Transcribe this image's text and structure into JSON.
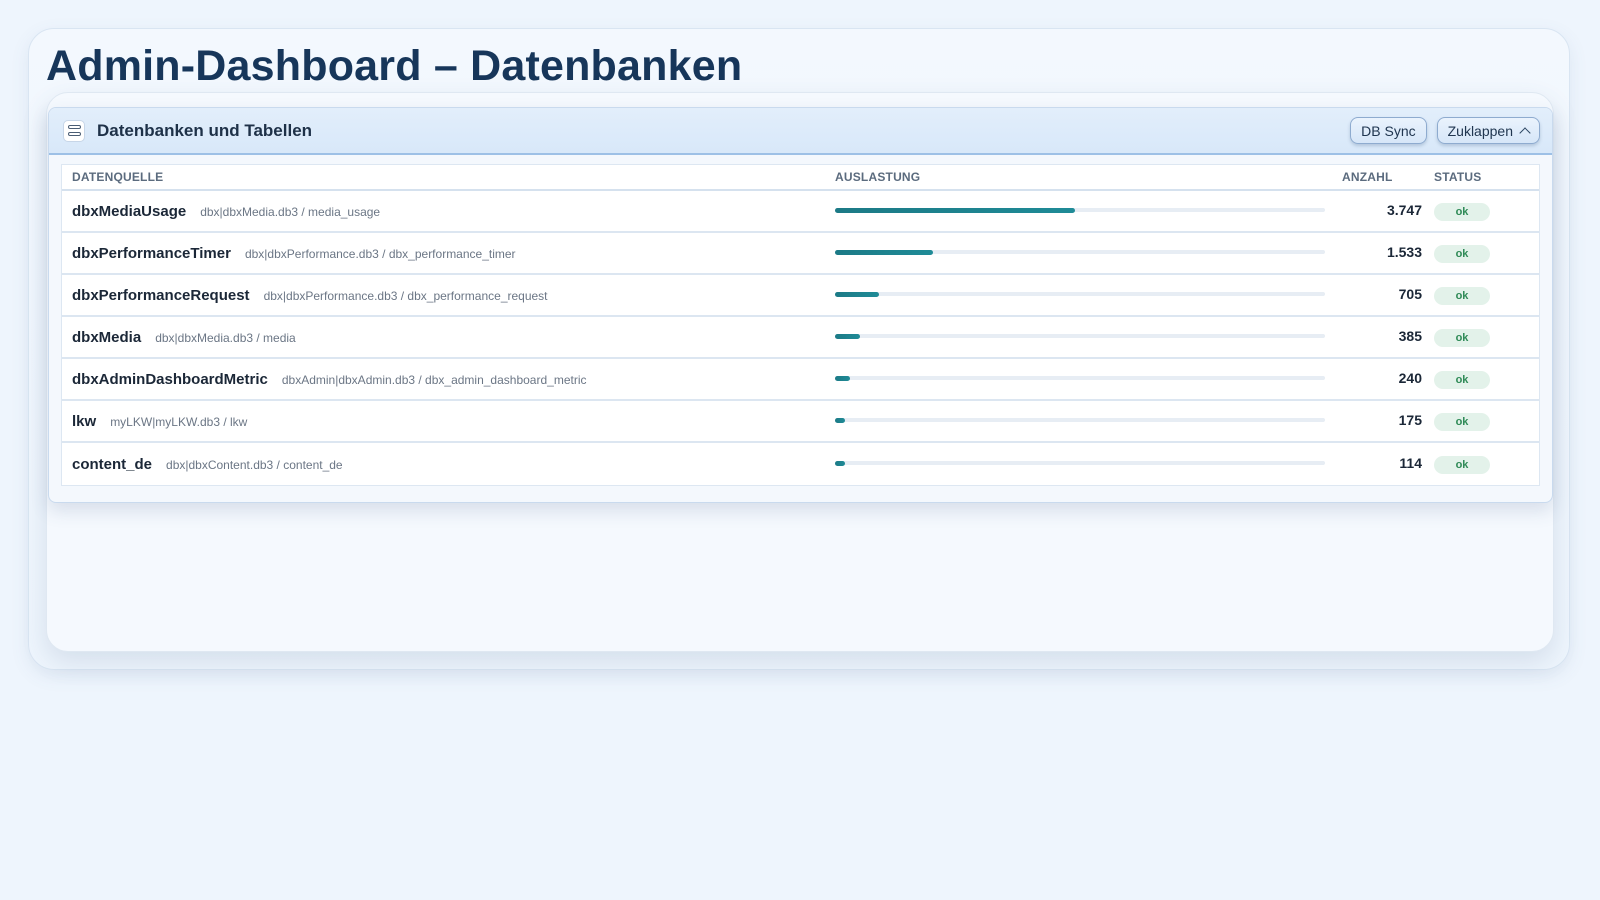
{
  "page": {
    "title": "Admin-Dashboard – Datenbanken"
  },
  "card": {
    "title": "Datenbanken und Tabellen",
    "icon": "database-icon",
    "actions": {
      "sync_label": "DB Sync",
      "collapse_label": "Zuklappen",
      "collapse_icon": "chevron-up-icon"
    }
  },
  "table": {
    "headers": {
      "source": "Datenquelle",
      "load": "Auslastung",
      "count": "Anzahl",
      "status": "Status"
    },
    "rows": [
      {
        "name": "dbxMediaUsage",
        "path": "dbx|dbxMedia.db3 / media_usage",
        "load": 0.49,
        "count": "3.747",
        "status": "ok"
      },
      {
        "name": "dbxPerformanceTimer",
        "path": "dbx|dbxPerformance.db3 / dbx_performance_timer",
        "load": 0.2,
        "count": "1.533",
        "status": "ok"
      },
      {
        "name": "dbxPerformanceRequest",
        "path": "dbx|dbxPerformance.db3 / dbx_performance_request",
        "load": 0.09,
        "count": "705",
        "status": "ok"
      },
      {
        "name": "dbxMedia",
        "path": "dbx|dbxMedia.db3 / media",
        "load": 0.05,
        "count": "385",
        "status": "ok"
      },
      {
        "name": "dbxAdminDashboardMetric",
        "path": "dbxAdmin|dbxAdmin.db3 / dbx_admin_dashboard_metric",
        "load": 0.03,
        "count": "240",
        "status": "ok"
      },
      {
        "name": "lkw",
        "path": "myLKW|myLKW.db3 / lkw",
        "load": 0.02,
        "count": "175",
        "status": "ok"
      },
      {
        "name": "content_de",
        "path": "dbx|dbxContent.db3 / content_de",
        "load": 0.02,
        "count": "114",
        "status": "ok"
      }
    ]
  },
  "colors": {
    "bar": "#1c7a86",
    "status_ok_bg": "#e3f2ea",
    "status_ok_text": "#2e8a56",
    "title": "#17365a"
  }
}
